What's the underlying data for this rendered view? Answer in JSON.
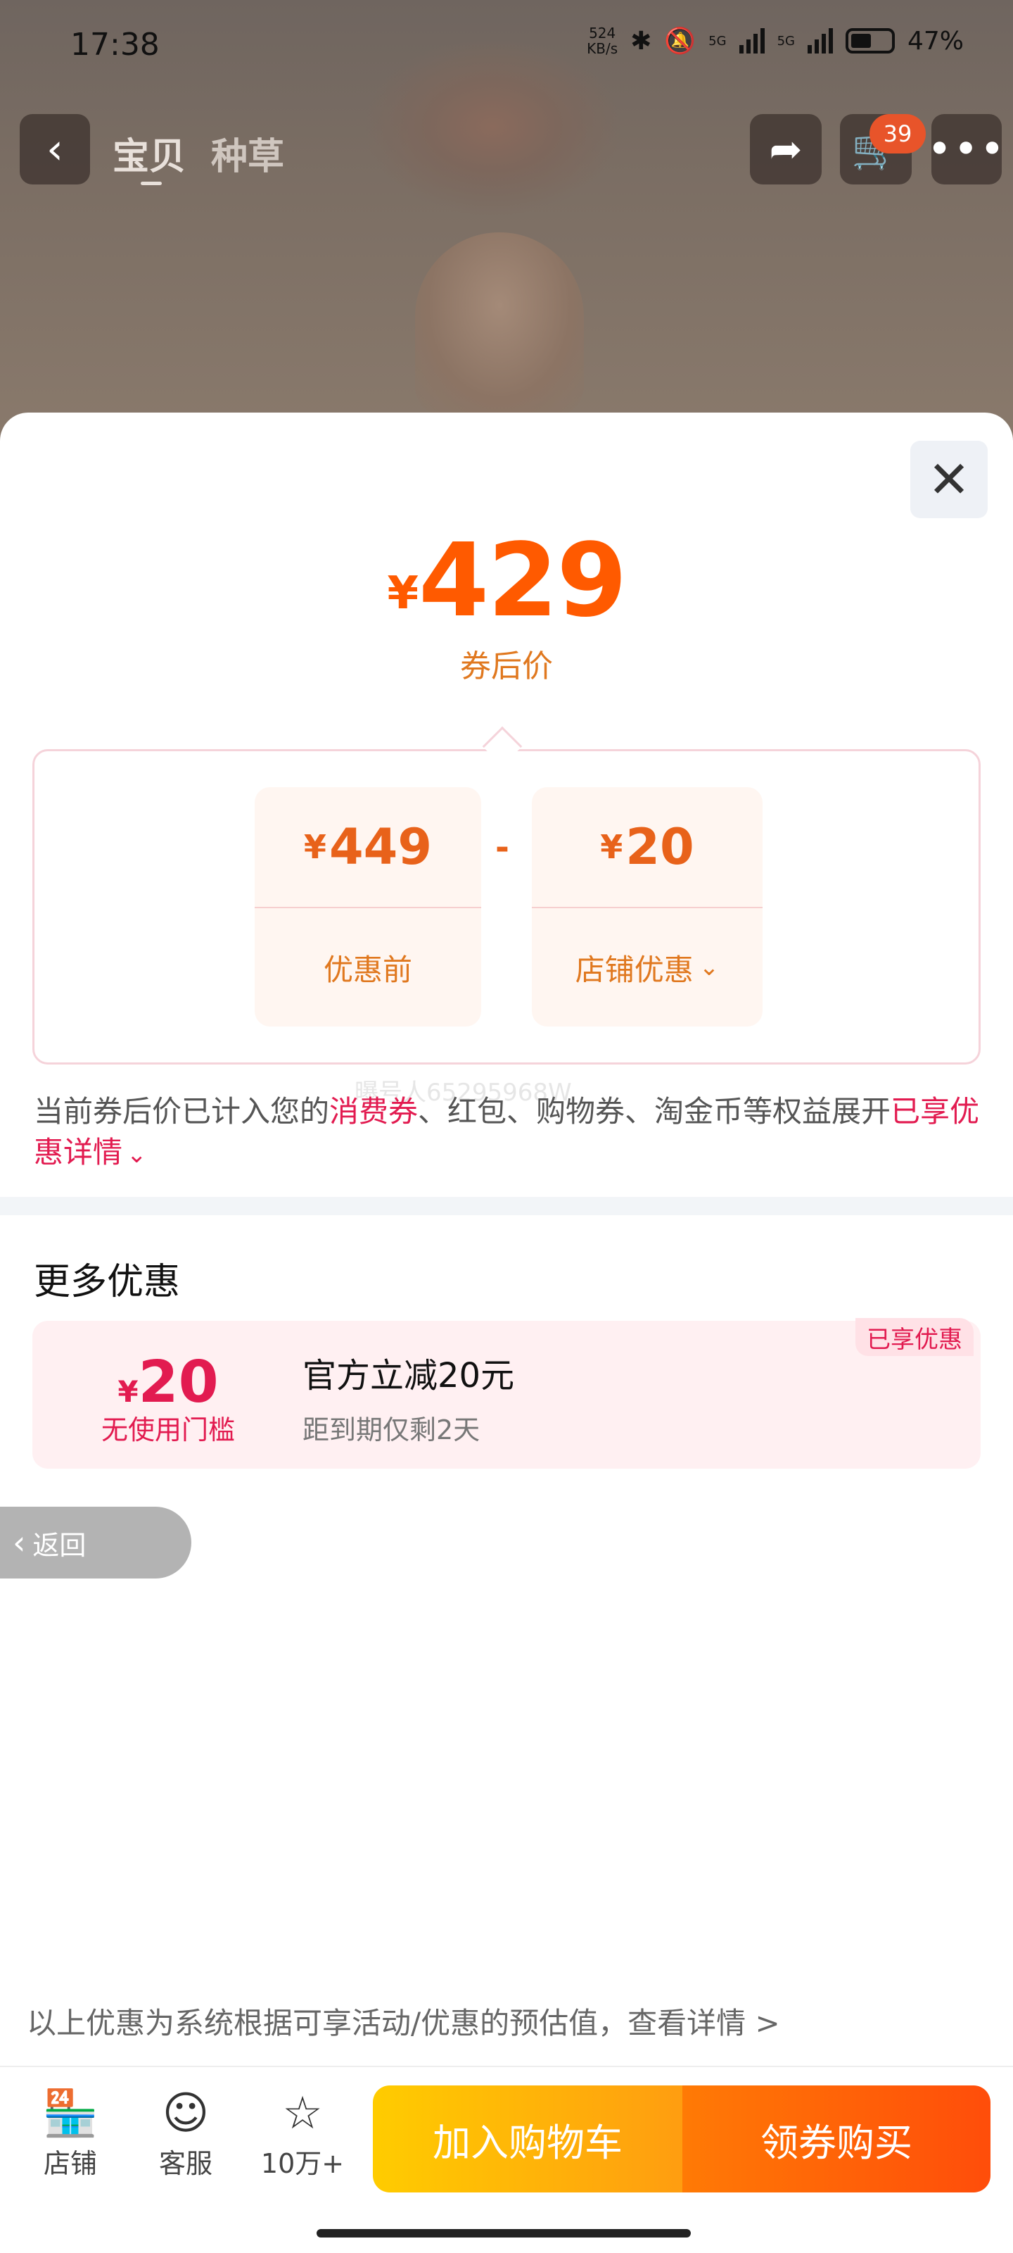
{
  "status_bar": {
    "time": "17:38",
    "net_speed": "524",
    "net_unit": "KB/s",
    "net1": "5G",
    "net2": "5G",
    "battery": "47%"
  },
  "nav": {
    "tabs": [
      "宝贝",
      "种草"
    ],
    "cart_badge": "39"
  },
  "price": {
    "currency": "¥",
    "amount": "429",
    "label": "券后价"
  },
  "calc": {
    "original_value": "449",
    "original_label": "优惠前",
    "operator": "-",
    "discount_value": "20",
    "discount_label": "店铺优惠"
  },
  "note": {
    "part1": "当前券后价已计入您的",
    "highlight1": "消费券",
    "part2": "、红包、购物券、淘金币等权益展开",
    "highlight2": "已享优惠详情"
  },
  "watermark": "曝号人65295968W",
  "more": {
    "title": "更多优惠",
    "coupon": {
      "currency": "¥",
      "amount": "20",
      "threshold": "无使用门槛",
      "name": "官方立减20元",
      "expiry": "距到期仅剩2天",
      "tag": "已享优惠"
    }
  },
  "return_label": "返回",
  "footnote": "以上优惠为系统根据可享活动/优惠的预估值，查看详情 >",
  "bottom_bar": {
    "store": "店铺",
    "service": "客服",
    "favorites": "10万+",
    "add_cart": "加入购物车",
    "buy": "领券购买"
  }
}
